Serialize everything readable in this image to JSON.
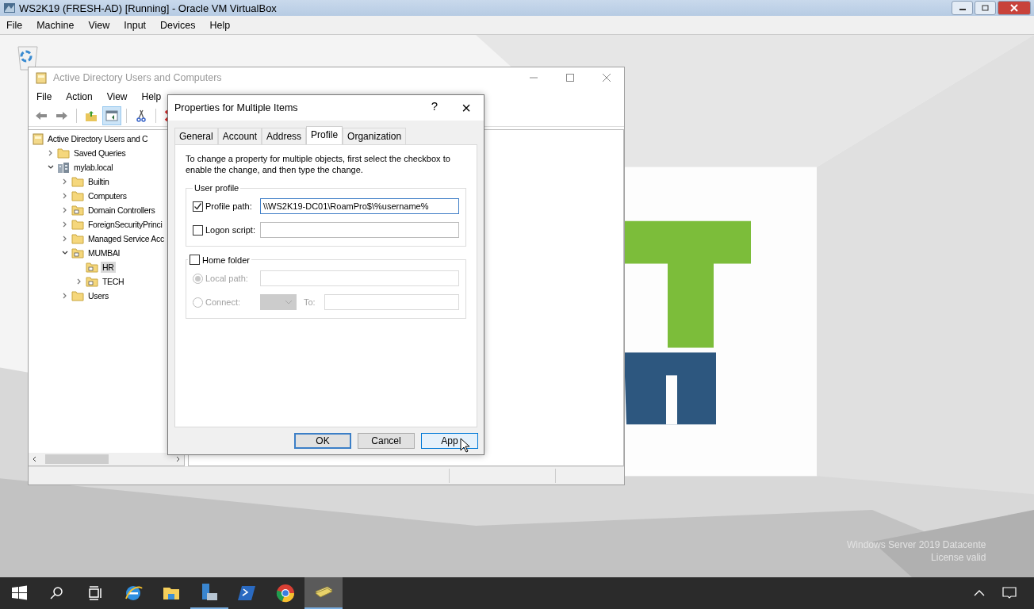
{
  "host_window": {
    "title": "WS2K19 (FRESH-AD) [Running] - Oracle VM VirtualBox"
  },
  "host_menu": [
    "File",
    "Machine",
    "View",
    "Input",
    "Devices",
    "Help"
  ],
  "desktop": {
    "background": {
      "kind": "picture"
    },
    "watermark": [
      "Windows Server 2019 Datacente",
      "License valid"
    ]
  },
  "aduc": {
    "title": "Active Directory Users and Computers",
    "menu": [
      "File",
      "Action",
      "View",
      "Help"
    ],
    "toolbar": [
      {
        "kind": "back",
        "pressed": false
      },
      {
        "kind": "forward",
        "pressed": false
      },
      {
        "kind": "up",
        "pressed": false
      },
      {
        "kind": "tree",
        "pressed": true
      },
      {
        "kind": "cut",
        "pressed": false
      },
      {
        "kind": "delete",
        "pressed": false
      }
    ],
    "tree": [
      {
        "label": "Active Directory Users and C",
        "kind": "root",
        "selected": false,
        "children": [
          {
            "label": "Saved Queries",
            "kind": "folder",
            "expanded": false,
            "selected": false
          },
          {
            "label": "mylab.local",
            "kind": "domain",
            "expanded": true,
            "selected": false,
            "children": [
              {
                "label": "Builtin",
                "kind": "folder",
                "expanded": false,
                "selected": false
              },
              {
                "label": "Computers",
                "kind": "folder",
                "expanded": false,
                "selected": false
              },
              {
                "label": "Domain Controllers",
                "kind": "ou",
                "expanded": false,
                "selected": false
              },
              {
                "label": "ForeignSecurityPrinci",
                "kind": "folder",
                "expanded": false,
                "selected": false
              },
              {
                "label": "Managed Service Acc",
                "kind": "folder",
                "expanded": false,
                "selected": false
              },
              {
                "label": "MUMBAI",
                "kind": "ou",
                "expanded": true,
                "selected": false,
                "children": [
                  {
                    "label": "HR",
                    "kind": "ou",
                    "selected": true
                  },
                  {
                    "label": "TECH",
                    "kind": "ou",
                    "expanded": false,
                    "selected": false
                  }
                ]
              },
              {
                "label": "Users",
                "kind": "folder",
                "expanded": false,
                "selected": false
              }
            ]
          }
        ]
      }
    ]
  },
  "dialog": {
    "title": "Properties for Multiple Items",
    "help": "?",
    "close": "×",
    "tabs": [
      {
        "label": "General",
        "selected": false
      },
      {
        "label": "Account",
        "selected": false
      },
      {
        "label": "Address",
        "selected": false
      },
      {
        "label": "Profile",
        "selected": true
      },
      {
        "label": "Organization",
        "selected": false
      }
    ],
    "intro": "To change a property for multiple objects, first select the checkbox to enable the change, and then type the change.",
    "user_profile": {
      "label": "User profile",
      "rows": [
        {
          "label": "Profile path:",
          "checked": true,
          "value": "\\\\WS2K19-DC01\\RoamPro$\\%username%",
          "focused": true
        },
        {
          "label": "Logon script:",
          "checked": false,
          "focused": false
        }
      ]
    },
    "home_folder": {
      "label": "Home folder",
      "checked": false,
      "options": [
        {
          "label": "Local path:",
          "selected": true
        },
        {
          "label": "Connect:",
          "selected": false
        }
      ],
      "to_label": "To:"
    },
    "buttons": [
      {
        "label": "OK",
        "default": true
      },
      {
        "label": "Cancel",
        "default": false
      },
      {
        "label": "App",
        "default": false
      }
    ]
  },
  "taskbar": [
    {
      "kind": "start",
      "running": false,
      "active": false
    },
    {
      "kind": "search",
      "running": false,
      "active": false
    },
    {
      "kind": "taskview",
      "running": false,
      "active": false
    },
    {
      "kind": "ie",
      "running": false,
      "active": false
    },
    {
      "kind": "explorer",
      "running": false,
      "active": false
    },
    {
      "kind": "server",
      "running": true,
      "active": false
    },
    {
      "kind": "powershell",
      "running": false,
      "active": false
    },
    {
      "kind": "chrome",
      "running": false,
      "active": false
    },
    {
      "kind": "aduc",
      "running": true,
      "active": true
    }
  ]
}
